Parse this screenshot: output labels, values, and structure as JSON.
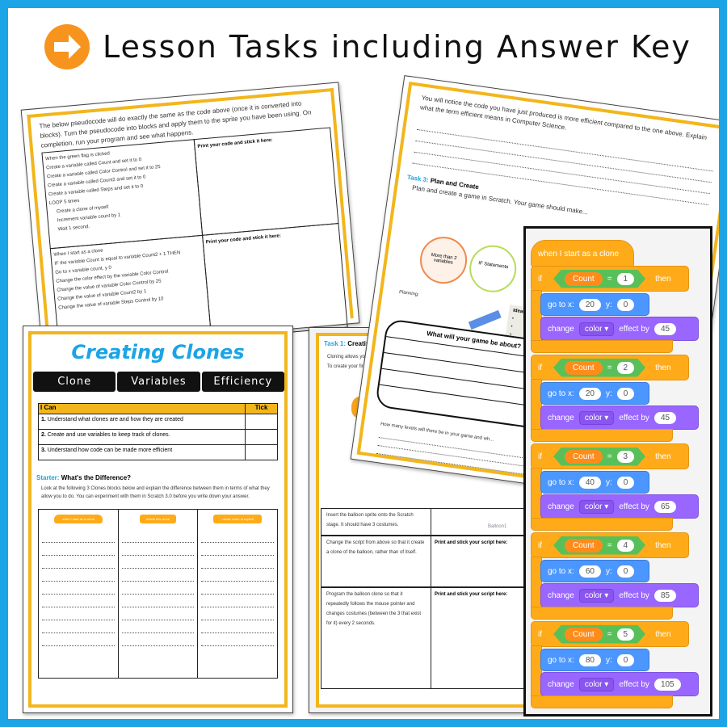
{
  "header": {
    "title": "Lesson Tasks including Answer Key",
    "icon": "arrow-right-circle-icon",
    "accent": "#f7941d",
    "border_color": "#1ba4e6"
  },
  "page_pseudocode": {
    "intro": "The below pseudocode will do exactly the same as the code above (once it is converted into blocks). Turn the pseudocode into blocks and apply them to the sprite you have been using. On completion, run your program and see what happens.",
    "print_label": "Print your code and stick it here:",
    "block1": [
      "When the green flag is clicked",
      "Create a variable called Count and set it to 0",
      "Create a variable called Color Control and set it to 25",
      "Create a variable called Count2 and set it to 0",
      "Create a variable called Steps and set it to 0",
      "LOOP 5 times",
      "Create a clone of myself",
      "Increment variable count by 1",
      "Wait 1 second."
    ],
    "block2": [
      "When I start as a clone",
      "IF the variable Count is equal to variable Count2 + 1 THEN",
      "Go to x variable count, y 0",
      "Change the color effect by the variable Color Control",
      "Change the value of variable Color Control by 25",
      "Change the value of variable Count2 by 1",
      "Change the value of variable Steps Control by 10"
    ]
  },
  "page_efficiency": {
    "question": "You will notice the code you have just produced is more efficient compared to the one above. Explain what the term efficient means in Computer Science.",
    "task_label": "Task 3:",
    "task_title": "Plan and Create",
    "task_text": "Plan and create a game in Scratch. Your game should make...",
    "bubbles": [
      "More than 2 variables",
      "IF Statements"
    ],
    "planning": "Planning:",
    "about": "What will your game be about?",
    "ideas": "Ideas",
    "levels": "How many levels will there be in your game and wh..."
  },
  "page_main": {
    "title": "Creating Clones",
    "tabs": [
      "Clone",
      "Variables",
      "Efficiency"
    ],
    "table_header": [
      "I Can",
      "Tick"
    ],
    "objectives": [
      {
        "n": "1.",
        "text": "Understand what clones are and how they are created"
      },
      {
        "n": "2.",
        "text": "Create and use variables to keep track of clones."
      },
      {
        "n": "3.",
        "text": "Understand how code can be made more efficient"
      }
    ],
    "starter_label": "Starter:",
    "starter_title": "What's the Difference?",
    "starter_text": "Look at the following 3 Clones blocks below and explain the difference between them in terms of what they allow you to do. You can experiment with them in Scratch 3.0 before you write down your answer.",
    "blocks": [
      "when I start as a clone",
      "delete this clone",
      "create clone of",
      "myself"
    ]
  },
  "page_task1": {
    "task_label": "Task 1:",
    "task_title": "Creating my...",
    "bullets": [
      "Cloning allows you... clones whilst it exe...",
      "To create your fir... begin to attach th..."
    ],
    "rows": [
      {
        "text": "Insert the balloon sprite onto the Scratch stage. It should have 3 costumes.",
        "right": "Balloon1"
      },
      {
        "text": "Change the script from above so that it create a clone of the balloon, rather than of itself.",
        "right": "Print and stick your script here:"
      },
      {
        "text": "Program the balloon clone so that it repeatedly follows the mouse pointer and changes costumes (between the 3 that exist for it) every 2 seconds.",
        "right": "Print and stick your script here:"
      }
    ]
  },
  "scratch": {
    "hat": "when I start as a clone",
    "if": "if",
    "then": "then",
    "variable": "Count",
    "eq": "=",
    "goto": "go to x:",
    "y": "y:",
    "change": "change",
    "effect": "color",
    "effect_by": "effect by",
    "blocks": [
      {
        "count": "1",
        "x": "20",
        "y": "0",
        "by": "45"
      },
      {
        "count": "2",
        "x": "20",
        "y": "0",
        "by": "45"
      },
      {
        "count": "3",
        "x": "40",
        "y": "0",
        "by": "65"
      },
      {
        "count": "4",
        "x": "60",
        "y": "0",
        "by": "85"
      },
      {
        "count": "5",
        "x": "80",
        "y": "0",
        "by": "105"
      }
    ]
  }
}
